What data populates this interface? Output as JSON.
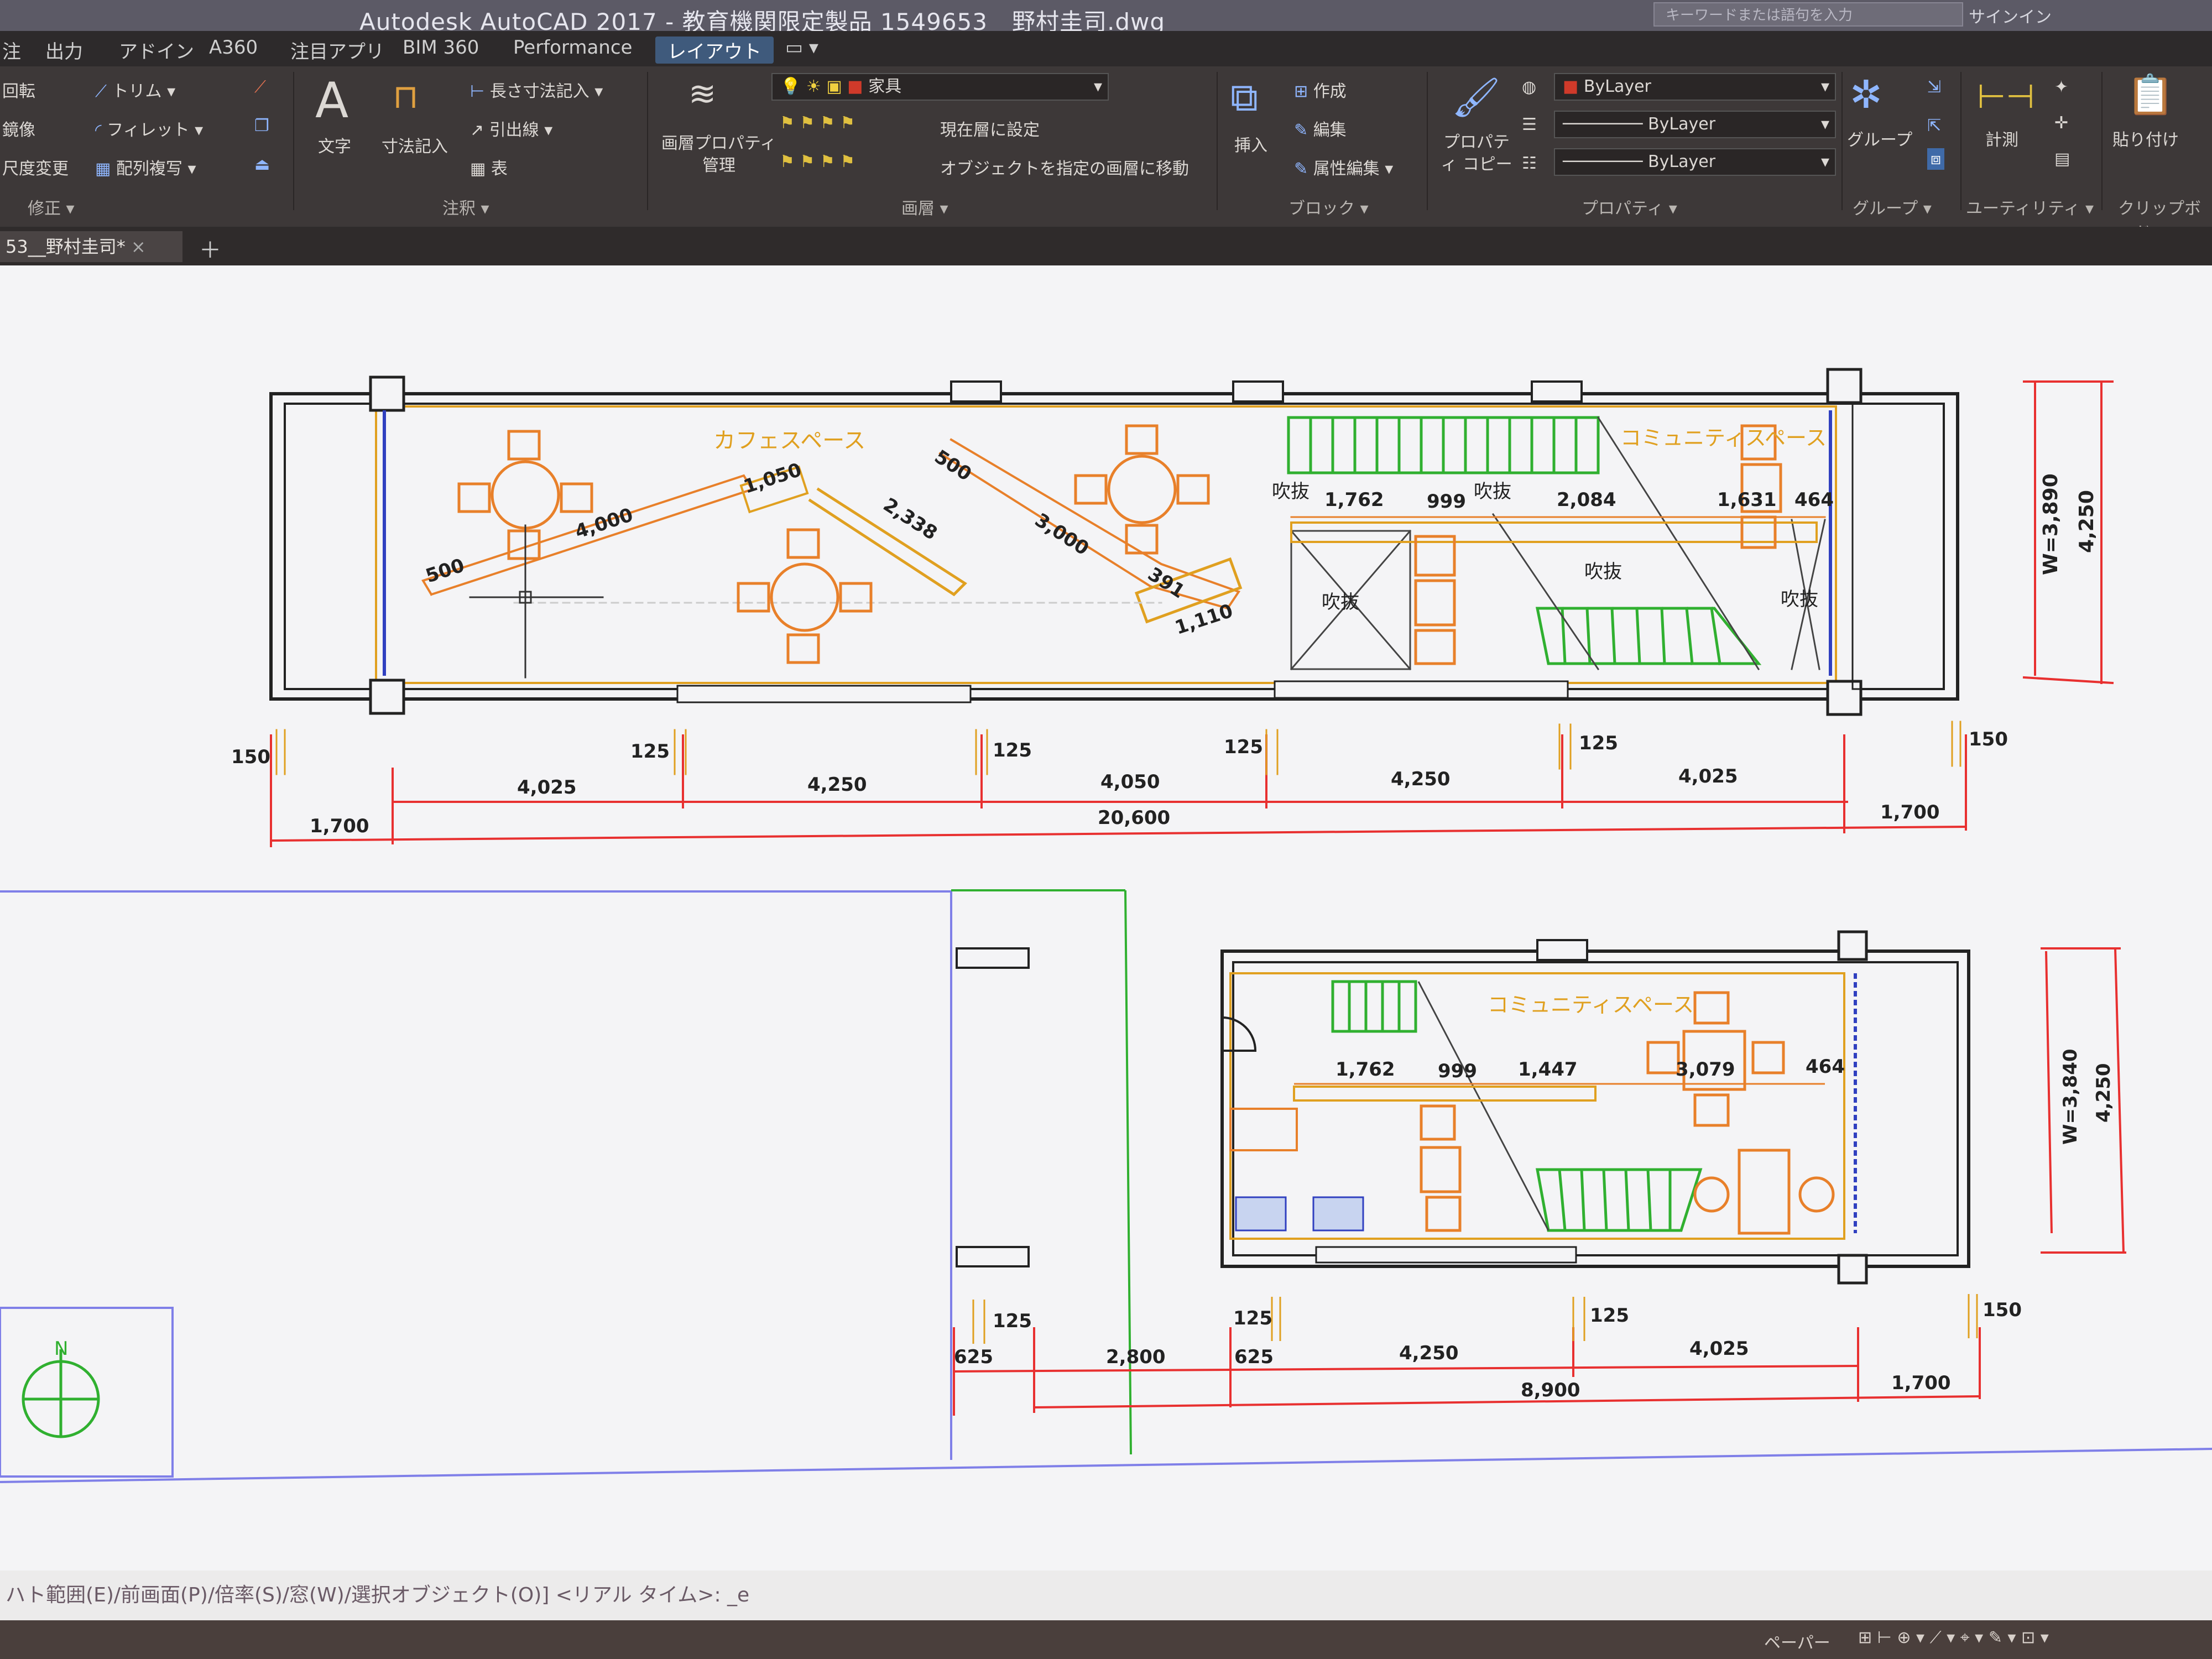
{
  "window": {
    "title": "Autodesk AutoCAD 2017 - 教育機関限定製品    1549653__野村圭司.dwg",
    "search_placeholder": "キーワードまたは語句を入力",
    "signin": "サインイン"
  },
  "menu": {
    "tabs": [
      "注",
      "出力",
      "アドイン",
      "A360",
      "注目アプリ",
      "BIM 360",
      "Performance",
      "レイアウト"
    ],
    "active": "レイアウト"
  },
  "ribbon": {
    "modify": {
      "rotate": "回転",
      "mirror": "鏡像",
      "scale": "尺度変更",
      "trim": "トリム",
      "fillet": "フィレット",
      "array": "配列複写",
      "label": "修正"
    },
    "annotation": {
      "text": "文字",
      "dimension": "寸法記入",
      "linear": "長さ寸法記入",
      "leader": "引出線",
      "table": "表",
      "label": "注釈"
    },
    "layers": {
      "layer_props": "画層プロパティ管理",
      "current": "家具",
      "set_current": "現在層に設定",
      "match": "オブジェクトを指定の画層に移動",
      "label": "画層"
    },
    "block": {
      "insert": "挿入",
      "create": "作成",
      "edit": "編集",
      "attr": "属性編集",
      "label": "ブロック"
    },
    "properties": {
      "match": "プロパティ コピー",
      "color": "ByLayer",
      "linetype": "ByLayer",
      "lineweight": "ByLayer",
      "label": "プロパティ"
    },
    "groups": {
      "group": "グループ",
      "label": "グループ"
    },
    "utilities": {
      "measure": "計測",
      "label": "ユーティリティ"
    },
    "clipboard": {
      "paste": "貼り付け",
      "label": "クリップボード"
    }
  },
  "document": {
    "tab_label": "53__野村圭司*"
  },
  "drawing": {
    "top_plan": {
      "room_label_cafe": "カフェスペース",
      "room_label_community": "コミュニティスペース",
      "void_labels": [
        "吹抜",
        "吹抜",
        "吹抜",
        "吹抜",
        "吹抜"
      ],
      "dims_counter": [
        "500",
        "4,000",
        "1,050",
        "2,338",
        "500",
        "3,000",
        "391",
        "1,110"
      ],
      "dims_right": [
        "1,762",
        "999",
        "2,084",
        "1,631",
        "464"
      ],
      "width_label": "W=3,890",
      "height_dim": "4,250",
      "bottom_small": [
        "150",
        "125",
        "125",
        "125",
        "125",
        "150"
      ],
      "bottom_spans": [
        "4,025",
        "4,250",
        "4,050",
        "4,250",
        "4,025"
      ],
      "bottom_total": [
        "1,700",
        "20,600",
        "1,700"
      ]
    },
    "bottom_plan": {
      "room_label": "コミュニティスペース",
      "dims_row": [
        "1,762",
        "999",
        "1,447",
        "3,079",
        "464"
      ],
      "width_label": "W=3,840",
      "height_dim": "4,250",
      "small": [
        "125",
        "625",
        "125",
        "625",
        "125",
        "150"
      ],
      "spans": [
        "2,800",
        "4,250",
        "4,025"
      ],
      "totals": [
        "8,900",
        "1,700"
      ],
      "north": "N"
    }
  },
  "command_line": "ハト範囲(E)/前画面(P)/倍率(S)/窓(W)/選択オブジェクト(O)] <リアル タイム>: _e",
  "status": {
    "paper": "ペーパー"
  }
}
